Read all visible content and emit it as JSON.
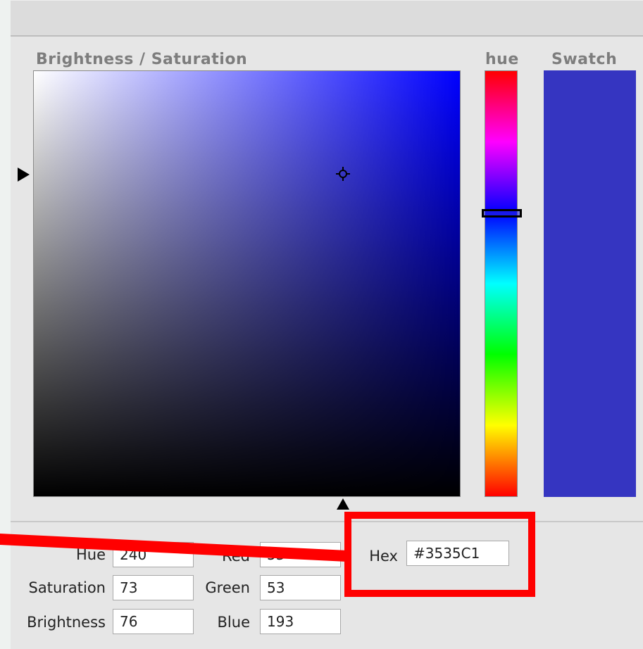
{
  "picker": {
    "sv_label": "Brightness / Saturation",
    "hue_label": "hue",
    "swatch_label": "Swatch"
  },
  "fields": {
    "hue": {
      "label": "Hue",
      "value": "240"
    },
    "saturation": {
      "label": "Saturation",
      "value": "73"
    },
    "brightness": {
      "label": "Brightness",
      "value": "76"
    },
    "red": {
      "label": "Red",
      "value": "53"
    },
    "green": {
      "label": "Green",
      "value": "53"
    },
    "blue": {
      "label": "Blue",
      "value": "193"
    },
    "hex": {
      "label": "Hex",
      "value": "#3535C1"
    }
  },
  "colors": {
    "swatch": "#3535C1",
    "annotation": "#FF0000"
  },
  "icons": {
    "vertical_marker": "triangle-right-icon",
    "horizontal_marker": "triangle-up-icon",
    "selection": "crosshair-icon"
  }
}
